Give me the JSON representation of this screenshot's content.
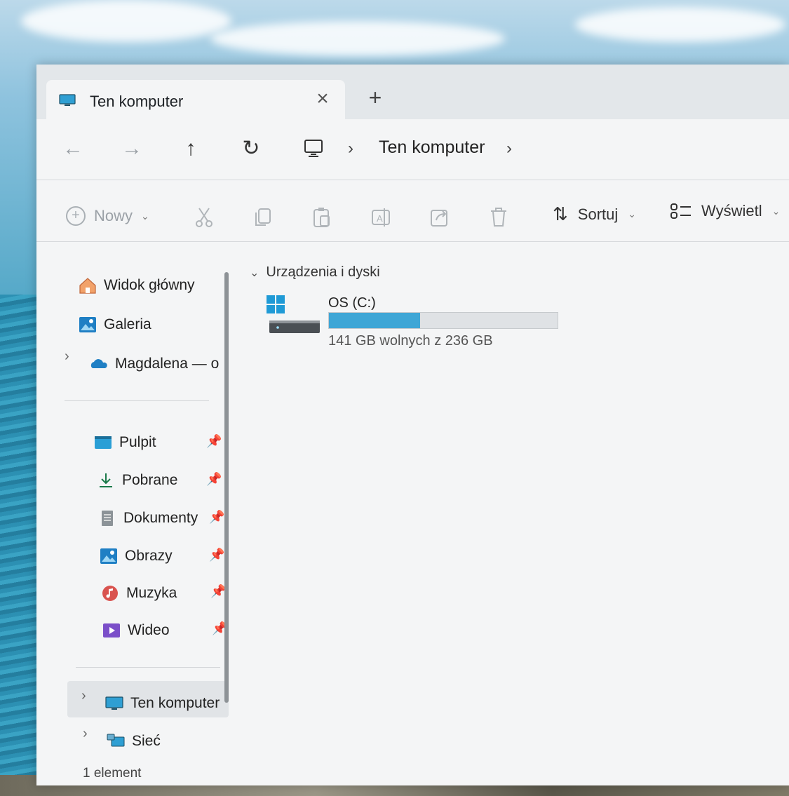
{
  "window": {
    "tab_title": "Ten komputer",
    "new_tab_symbol": "+",
    "close_symbol": "×"
  },
  "nav": {
    "back": "←",
    "forward": "→",
    "up": "↑",
    "refresh": "↻",
    "breadcrumb": [
      "Ten komputer"
    ],
    "sep": "›"
  },
  "toolbar": {
    "new_label": "Nowy",
    "sort_label": "Sortuj",
    "view_label": "Wyświetl",
    "icons": [
      "cut-icon",
      "copy-icon",
      "paste-icon",
      "rename-icon",
      "share-icon",
      "delete-icon"
    ]
  },
  "sidebar": {
    "top": [
      {
        "label": "Widok główny",
        "icon": "home-icon"
      },
      {
        "label": "Galeria",
        "icon": "gallery-icon"
      },
      {
        "label": "Magdalena — o",
        "icon": "onedrive-icon"
      }
    ],
    "pinned": [
      {
        "label": "Pulpit",
        "icon": "desktop-icon"
      },
      {
        "label": "Pobrane",
        "icon": "downloads-icon"
      },
      {
        "label": "Dokumenty",
        "icon": "documents-icon"
      },
      {
        "label": "Obrazy",
        "icon": "pictures-icon"
      },
      {
        "label": "Muzyka",
        "icon": "music-icon"
      },
      {
        "label": "Wideo",
        "icon": "videos-icon"
      }
    ],
    "bottom": [
      {
        "label": "Ten komputer",
        "icon": "this-pc-icon",
        "selected": true
      },
      {
        "label": "Sieć",
        "icon": "network-icon"
      }
    ]
  },
  "content": {
    "group_title": "Urządzenia i dyski",
    "drive": {
      "name": "OS (C:)",
      "free_text": "141 GB wolnych z 236 GB",
      "used_fraction": 0.4
    }
  },
  "status": {
    "count_text": "1 element"
  },
  "colors": {
    "accent": "#3ea6d6",
    "window_bg": "#f4f5f6"
  }
}
